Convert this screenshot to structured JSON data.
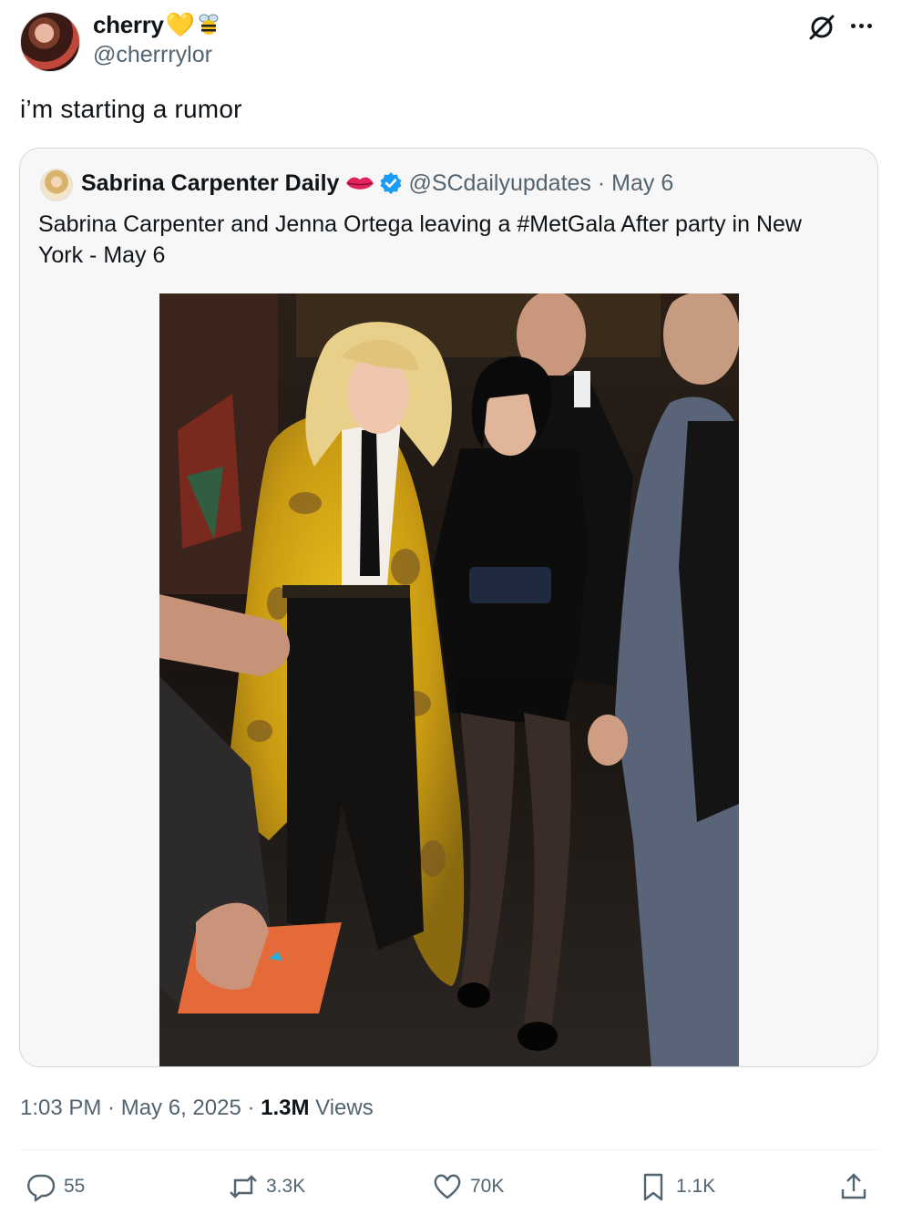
{
  "author": {
    "name": "cherry",
    "emoji_heart": "💛",
    "handle": "@cherrrylor"
  },
  "tweet_text": "i’m starting a rumor",
  "quoted": {
    "name": "Sabrina Carpenter Daily",
    "handle": "@SCdailyupdates",
    "date": "· May 6",
    "text": "Sabrina Carpenter and Jenna Ortega leaving a  #MetGala After party in New York - May 6"
  },
  "meta": {
    "time": "1:03 PM · May 6, 2025 · ",
    "views_count": "1.3M",
    "views_label": " Views"
  },
  "stats": {
    "replies": "55",
    "reposts": "3.3K",
    "likes": "70K",
    "bookmarks": "1.1K"
  },
  "colors": {
    "secondary_text": "#536471",
    "verified_blue": "#1d9bf0",
    "lips_red": "#e0245e",
    "heart_yellow": "#f7c948"
  }
}
